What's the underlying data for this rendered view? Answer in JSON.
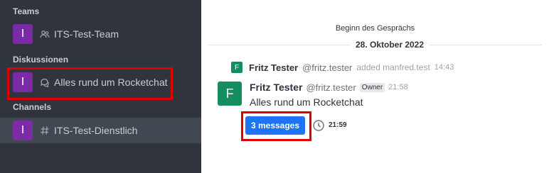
{
  "sidebar": {
    "sections": {
      "teams": "Teams",
      "discussions": "Diskussionen",
      "channels": "Channels"
    },
    "items": [
      {
        "avatar_letter": "I",
        "label": "ITS-Test-Team",
        "icon": "team-icon",
        "color": "#7b2ba6"
      },
      {
        "avatar_letter": "I",
        "label": "Alles rund um Rocketchat",
        "icon": "discussion-icon",
        "color": "#7b2ba6"
      },
      {
        "avatar_letter": "I",
        "label": "ITS-Test-Dienstlich",
        "icon": "channel-hash-icon",
        "color": "#7b2ba6"
      }
    ]
  },
  "main": {
    "begin_text": "Beginn des Gesprächs",
    "date_divider": "28. Oktober 2022",
    "system_message": {
      "avatar_letter": "F",
      "name": "Fritz Tester",
      "handle": "@fritz.tester",
      "text": "added manfred.test",
      "time": "14:43"
    },
    "message": {
      "avatar_letter": "F",
      "name": "Fritz Tester",
      "handle": "@fritz.tester",
      "role_badge": "Owner",
      "time": "21:58",
      "body": "Alles rund um Rocketchat",
      "thread_button": "3 messages",
      "thread_time": "21:59"
    }
  },
  "colors": {
    "sidebar_bg": "#2f343d",
    "accent_blue": "#1d74f5",
    "avatar_purple": "#7b2ba6",
    "avatar_green": "#158d5e",
    "highlight_red": "#e00000"
  }
}
